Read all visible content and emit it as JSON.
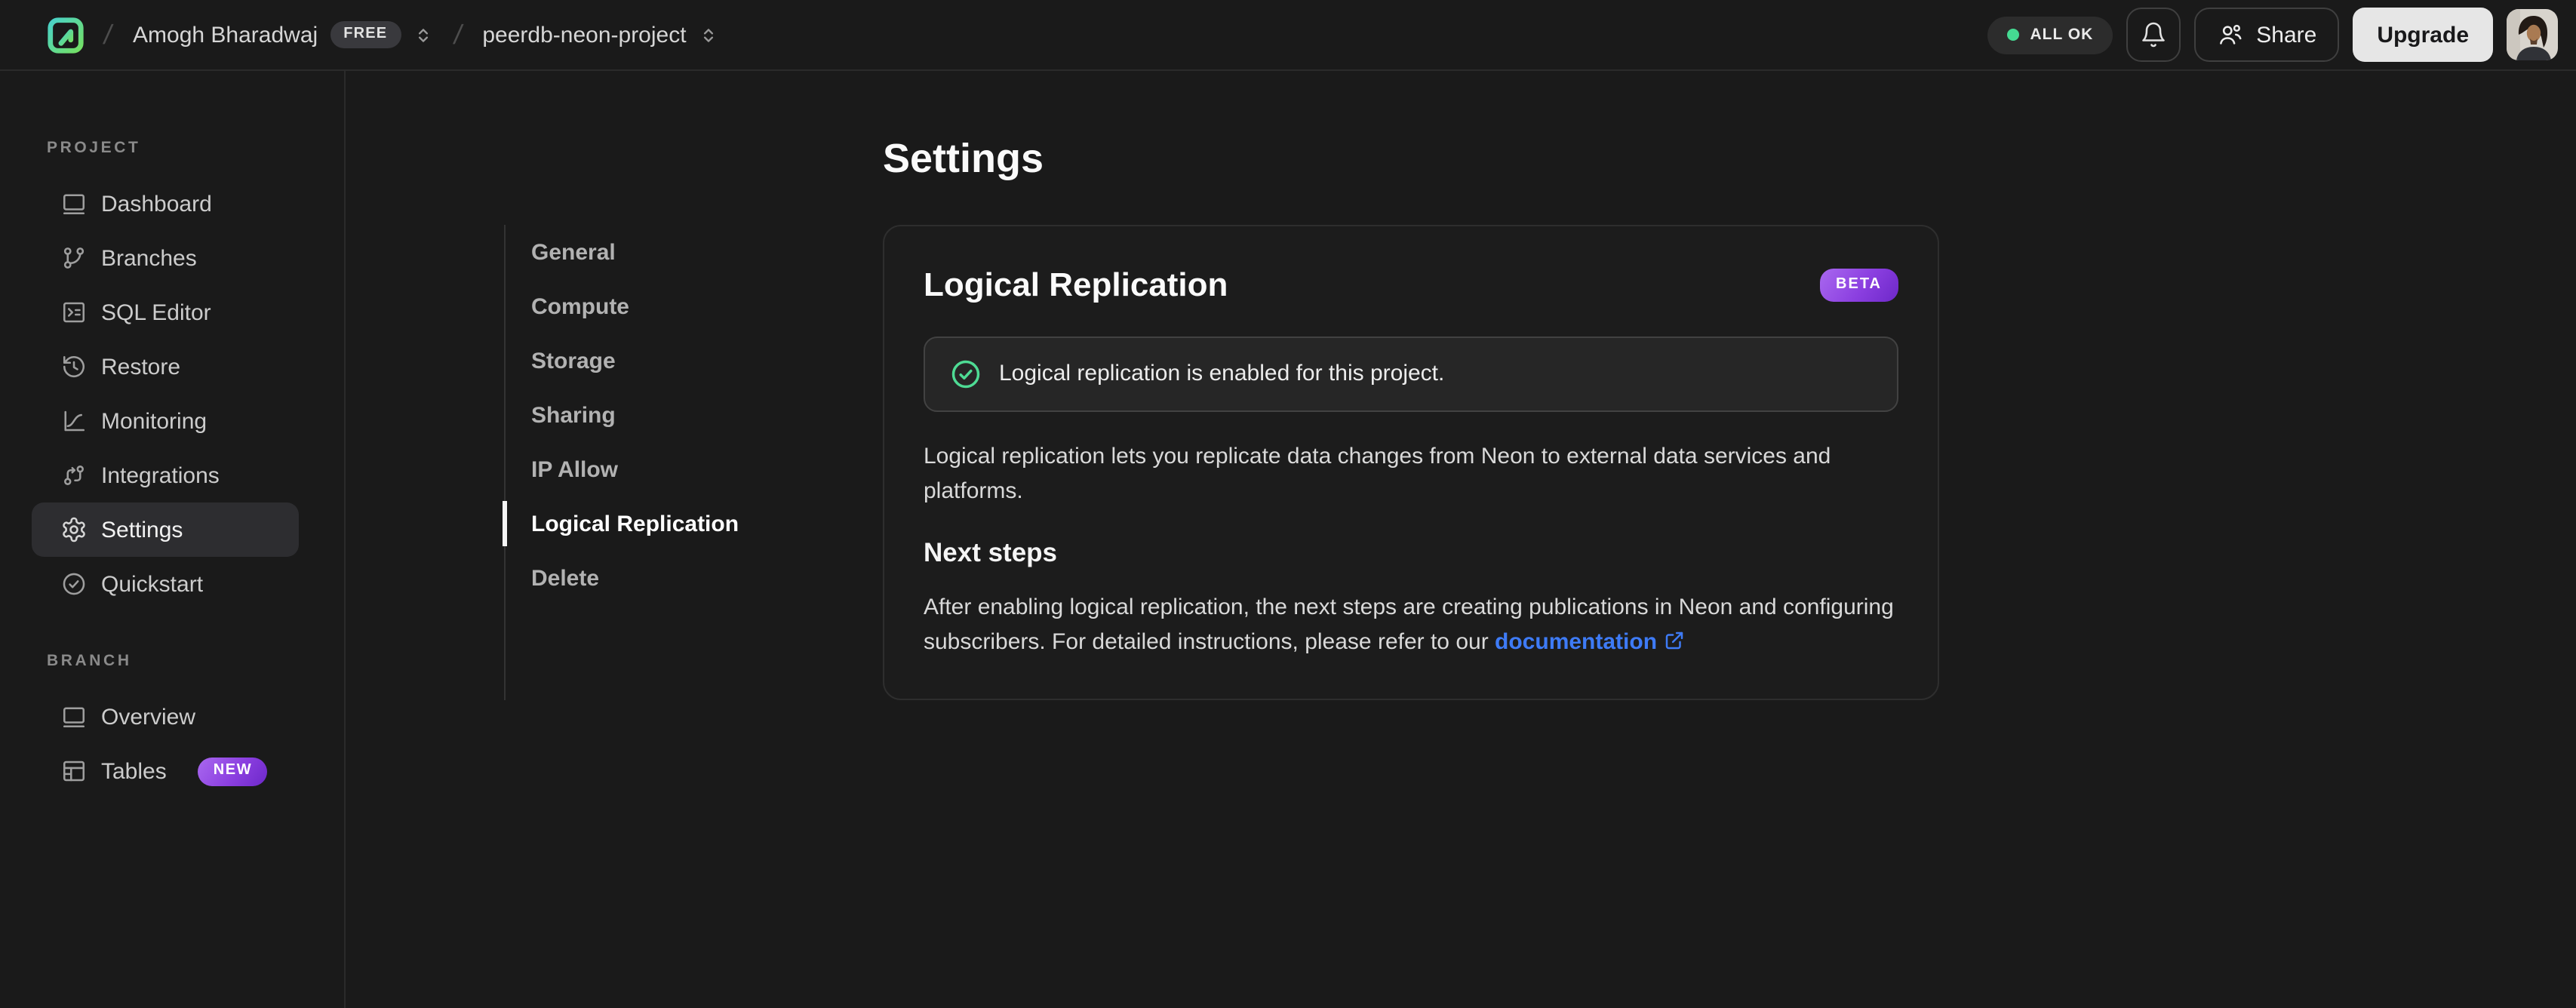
{
  "topbar": {
    "breadcrumb": {
      "separator": "/",
      "org": "Amogh Bharadwaj",
      "org_badge": "FREE",
      "project": "peerdb-neon-project"
    },
    "status_label": "ALL OK",
    "share_label": "Share",
    "upgrade_label": "Upgrade"
  },
  "sidebar": {
    "sections": [
      {
        "label": "PROJECT",
        "items": [
          {
            "label": "Dashboard",
            "icon": "dashboard-icon"
          },
          {
            "label": "Branches",
            "icon": "branches-icon"
          },
          {
            "label": "SQL Editor",
            "icon": "sql-editor-icon"
          },
          {
            "label": "Restore",
            "icon": "restore-icon"
          },
          {
            "label": "Monitoring",
            "icon": "monitoring-icon"
          },
          {
            "label": "Integrations",
            "icon": "integrations-icon"
          },
          {
            "label": "Settings",
            "icon": "settings-icon",
            "selected": true
          },
          {
            "label": "Quickstart",
            "icon": "quickstart-icon"
          }
        ]
      },
      {
        "label": "BRANCH",
        "items": [
          {
            "label": "Overview",
            "icon": "overview-icon"
          },
          {
            "label": "Tables",
            "icon": "tables-icon",
            "badge": "NEW"
          }
        ]
      }
    ]
  },
  "settings_nav": {
    "items": [
      "General",
      "Compute",
      "Storage",
      "Sharing",
      "IP Allow",
      "Logical Replication",
      "Delete"
    ],
    "selected": "Logical Replication"
  },
  "main": {
    "page_title": "Settings",
    "card": {
      "title": "Logical Replication",
      "badge": "BETA",
      "alert_text": "Logical replication is enabled for this project.",
      "description": "Logical replication lets you replicate data changes from Neon to external data services and platforms.",
      "next_steps_title": "Next steps",
      "next_steps_text": "After enabling logical replication, the next steps are creating publications in Neon and configuring subscribers. For detailed instructions, please refer to our",
      "link_label": "documentation"
    }
  },
  "colors": {
    "background": "#1a1a1a",
    "card_background": "#1c1c1c",
    "border": "#2b2b2b",
    "accent_green": "#45da92",
    "accent_purple": "#8b3fe0",
    "link_blue": "#3e7bf6",
    "selected_item": "#2d2d30"
  }
}
